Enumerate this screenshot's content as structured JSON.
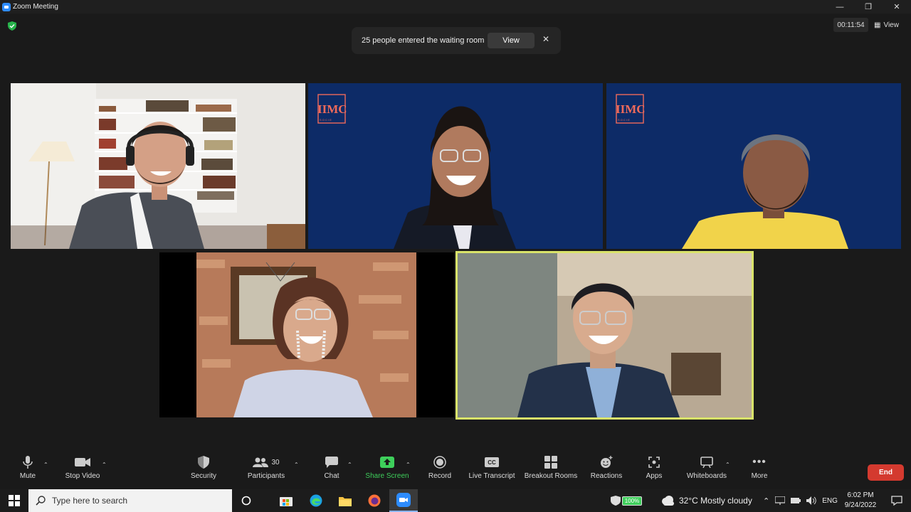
{
  "window": {
    "title": "Zoom Meeting"
  },
  "meeting": {
    "timer": "00:11:54",
    "view_label": "View"
  },
  "notification": {
    "message": "25 people entered the waiting room",
    "view_label": "View",
    "close_icon": "close-icon"
  },
  "tiles": [
    {
      "logo": "IIMC",
      "logo_sub": "S O C I E"
    },
    {
      "logo": "IIMC",
      "logo_sub": "S O C I E"
    }
  ],
  "toolbar": {
    "mute": "Mute",
    "stop_video": "Stop Video",
    "security": "Security",
    "participants": "Participants",
    "participants_count": "30",
    "chat": "Chat",
    "share_screen": "Share Screen",
    "record": "Record",
    "live_transcript": "Live Transcript",
    "breakout_rooms": "Breakout Rooms",
    "reactions": "Reactions",
    "apps": "Apps",
    "whiteboards": "Whiteboards",
    "more": "More",
    "end": "End",
    "cc_glyph": "CC"
  },
  "taskbar": {
    "search_placeholder": "Type here to search",
    "battery": "100%",
    "weather": "32°C  Mostly cloudy",
    "language": "ENG",
    "time": "6:02 PM",
    "date": "9/24/2022"
  },
  "colors": {
    "active_speaker_border": "#d9e36a",
    "share_green": "#3ecf5b",
    "end_red": "#d43a2f",
    "iimc_blue": "#0c2a66"
  }
}
